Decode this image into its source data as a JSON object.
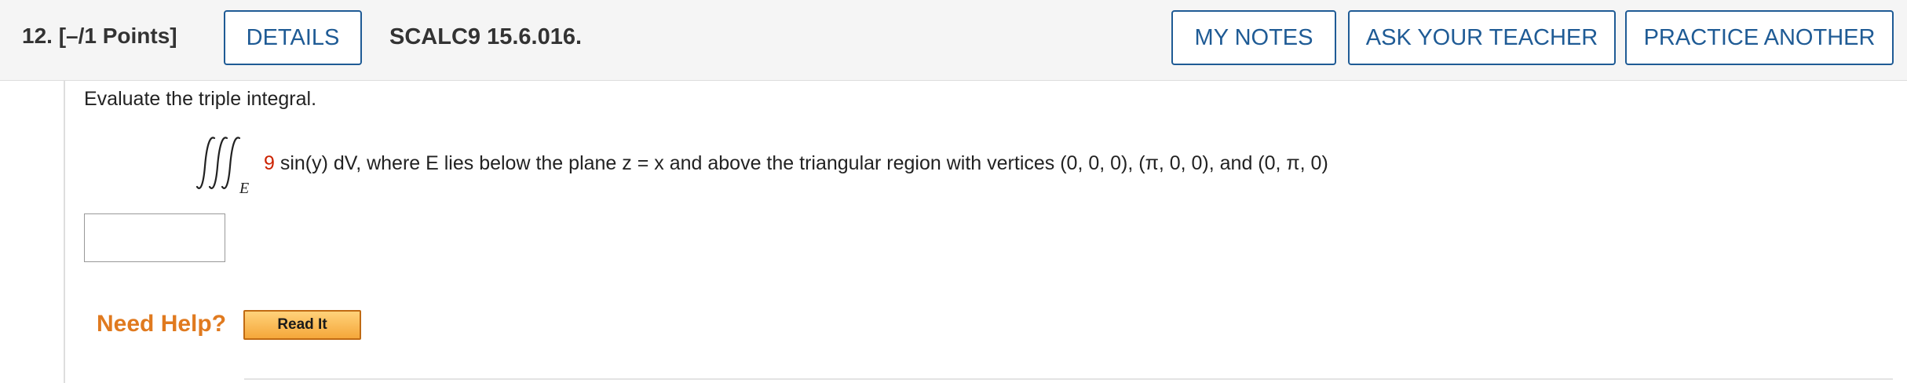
{
  "header": {
    "question_label": "12. [–/1 Points]",
    "details_label": "DETAILS",
    "problem_code": "SCALC9 15.6.016.",
    "my_notes_label": "MY NOTES",
    "ask_teacher_label": "ASK YOUR TEACHER",
    "practice_another_label": "PRACTICE ANOTHER"
  },
  "question": {
    "prompt": "Evaluate the triple integral.",
    "integral_region": "E",
    "coefficient": "9",
    "expression_rest": " sin(y) dV, where E lies below the plane z = x and above the triangular region with vertices (0, 0, 0), (π, 0, 0), and (0, π, 0)"
  },
  "answer": {
    "value": ""
  },
  "help": {
    "label": "Need Help?",
    "read_it_label": "Read It"
  },
  "colors": {
    "accent": "#1f5b95",
    "coefficient": "#cc2200",
    "need_help": "#e07a1f"
  }
}
